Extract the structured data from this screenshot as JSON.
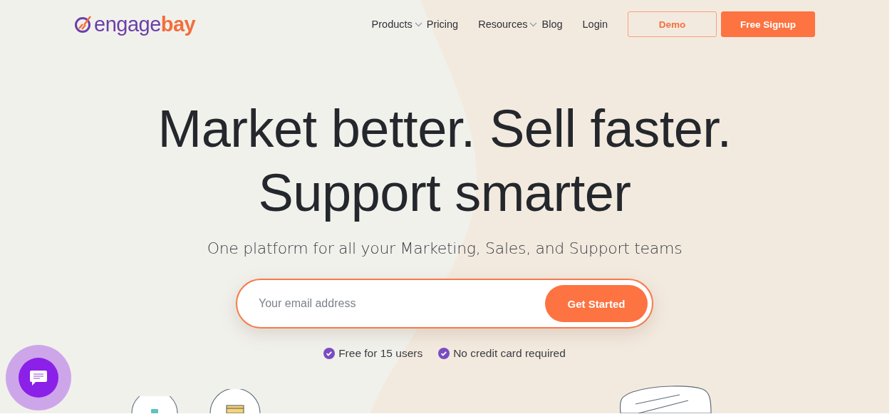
{
  "logo": {
    "primary": "engage",
    "secondary": "bay"
  },
  "nav": [
    {
      "label": "Products",
      "has_dropdown": true
    },
    {
      "label": "Pricing",
      "has_dropdown": false
    },
    {
      "label": "Resources",
      "has_dropdown": true
    },
    {
      "label": "Blog",
      "has_dropdown": false
    },
    {
      "label": "Login",
      "has_dropdown": false
    }
  ],
  "header_buttons": [
    {
      "label": "Demo",
      "kind": "outline"
    },
    {
      "label": "Free Signup",
      "kind": "filled"
    }
  ],
  "hero": {
    "headline_lines": [
      "Market better. Sell faster.",
      "Support smarter"
    ],
    "subtitle": "One platform for all your Marketing, Sales, and Support teams",
    "email": {
      "placeholder": "Your email address"
    },
    "cta": "Get Started",
    "perks": [
      "Free for 15 users",
      "No credit card required"
    ]
  }
}
